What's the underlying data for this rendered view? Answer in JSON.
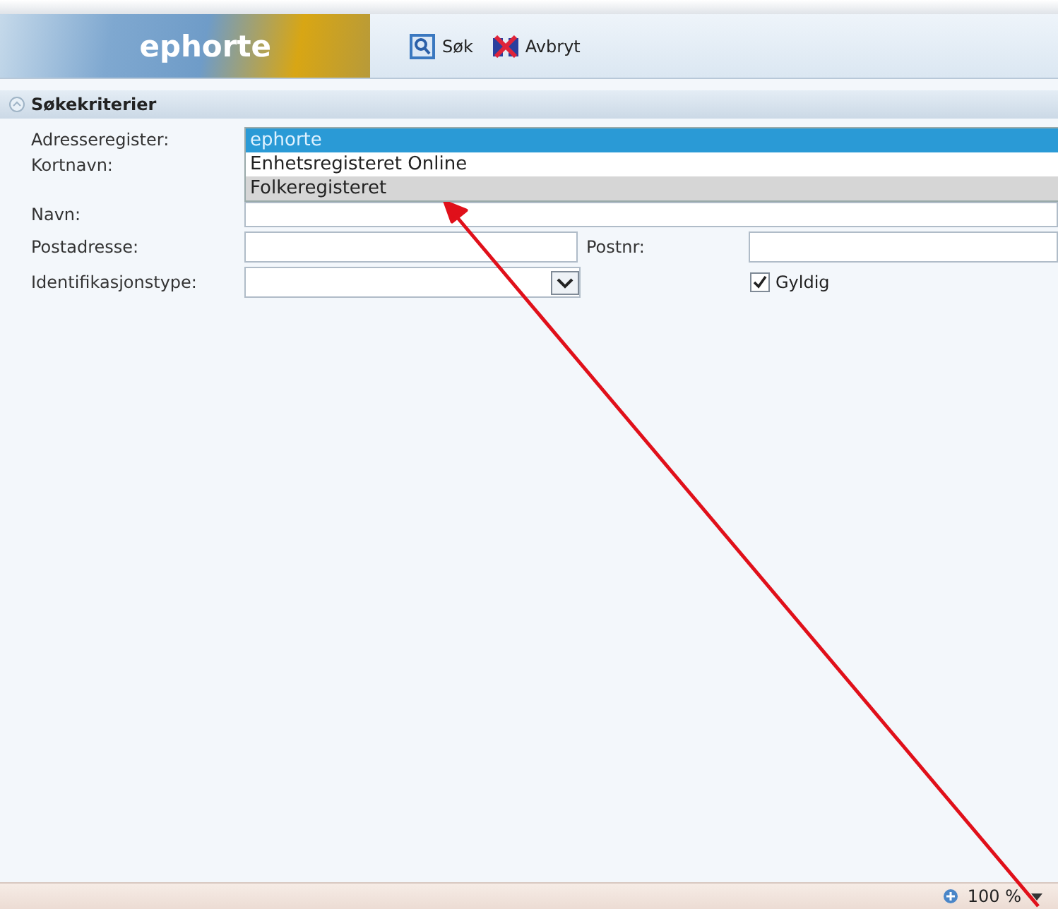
{
  "header": {
    "logo": "ephorte",
    "toolbar": [
      {
        "kind": "search",
        "label": "Søk"
      },
      {
        "kind": "cancel",
        "label": "Avbryt"
      }
    ]
  },
  "section": {
    "title": "Søkekriterier"
  },
  "form": {
    "address_register": {
      "label": "Adresseregister:",
      "options": [
        {
          "label": "ephorte",
          "selected": true,
          "highlighted": false
        },
        {
          "label": "Enhetsregisteret Online",
          "selected": false,
          "highlighted": false
        },
        {
          "label": "Folkeregisteret",
          "selected": false,
          "highlighted": true
        }
      ]
    },
    "short_name": {
      "label": "Kortnavn:"
    },
    "name": {
      "label": "Navn:"
    },
    "postal_address": {
      "label": "Postadresse:"
    },
    "postcode": {
      "label": "Postnr:"
    },
    "id_type": {
      "label": "Identifikasjonstype:"
    },
    "valid": {
      "label": "Gyldig",
      "checked": true
    }
  },
  "status_bar": {
    "zoom": "100 %"
  }
}
